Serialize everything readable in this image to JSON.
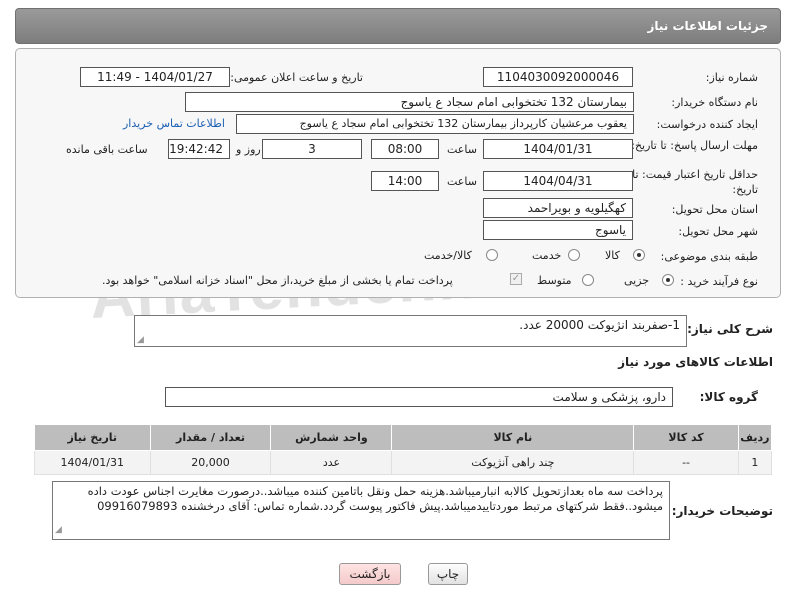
{
  "header": {
    "title": "جزئیات اطلاعات نیاز"
  },
  "watermark": "AriaTender.neT",
  "form": {
    "need_number_label": "شماره نیاز:",
    "need_number": "1104030092000046",
    "announce_label": "تاریخ و ساعت اعلان عمومی:",
    "announce_value": "1404/01/27 - 11:49",
    "buyer_org_label": "نام دستگاه خریدار:",
    "buyer_org": "بیمارستان 132 تختخوابی امام سجاد  ع  یاسوج",
    "creator_label": "ایجاد کننده درخواست:",
    "creator": "یعقوب مرعشیان کارپرداز بیمارستان 132 تختخوابی امام سجاد  ع  یاسوج",
    "contact_link": "اطلاعات تماس خریدار",
    "deadline_label": "مهلت ارسال پاسخ: تا تاریخ:",
    "deadline_date": "1404/01/31",
    "time_label": "ساعت",
    "deadline_time": "08:00",
    "days_value": "3",
    "days_label": "روز و",
    "remaining_time": "19:42:42",
    "remaining_label": "ساعت باقی مانده",
    "validity_label": "حداقل تاریخ اعتبار قیمت: تا تاریخ:",
    "validity_date": "1404/04/31",
    "validity_time": "14:00",
    "province_label": "استان محل تحویل:",
    "province": "کهگیلویه و بویراحمد",
    "city_label": "شهر محل تحویل:",
    "city": "یاسوج",
    "category_label": "طبقه بندی موضوعی:",
    "category_options": [
      "کالا",
      "خدمت",
      "کالا/خدمت"
    ],
    "category_selected": 0,
    "process_label": "نوع فرآیند خرید :",
    "process_options": [
      "جزیی",
      "متوسط"
    ],
    "process_selected": 0,
    "payment_note": "پرداخت تمام یا بخشی از مبلغ خرید،از محل \"اسناد خزانه اسلامی\" خواهد بود."
  },
  "description": {
    "label": "شرح کلی نیاز:",
    "text": "1-صفربند انژیوکت 20000 عدد."
  },
  "goods": {
    "section_title": "اطلاعات کالاهای مورد نیاز",
    "group_label": "گروه کالا:",
    "group_value": "دارو، پزشکی و سلامت",
    "columns": [
      "ردیف",
      "کد کالا",
      "نام کالا",
      "واحد شمارش",
      "تعداد / مقدار",
      "تاریخ نیاز"
    ],
    "rows": [
      [
        "1",
        "--",
        "چند راهی آنژیوکت",
        "عدد",
        "20,000",
        "1404/01/31"
      ]
    ]
  },
  "buyer_notes": {
    "label": "توضیحات خریدار:",
    "text": "پرداخت سه  ماه بعدازتحویل کالابه انبارمیباشد.هزینه حمل ونقل باتامین کننده میباشد..درصورت مغایرت اجناس عودت داده میشود..فقط شرکتهای مرتبط موردتاییدمیباشد.پیش فاکتور پیوست گردد.شماره تماس: آقای درخشنده 09916079893"
  },
  "buttons": {
    "print": "چاپ",
    "back": "بازگشت"
  },
  "colors": {
    "header_bg": "#8a8a8a",
    "link": "#1a5fb4",
    "table_header": "#bdbdbd"
  }
}
